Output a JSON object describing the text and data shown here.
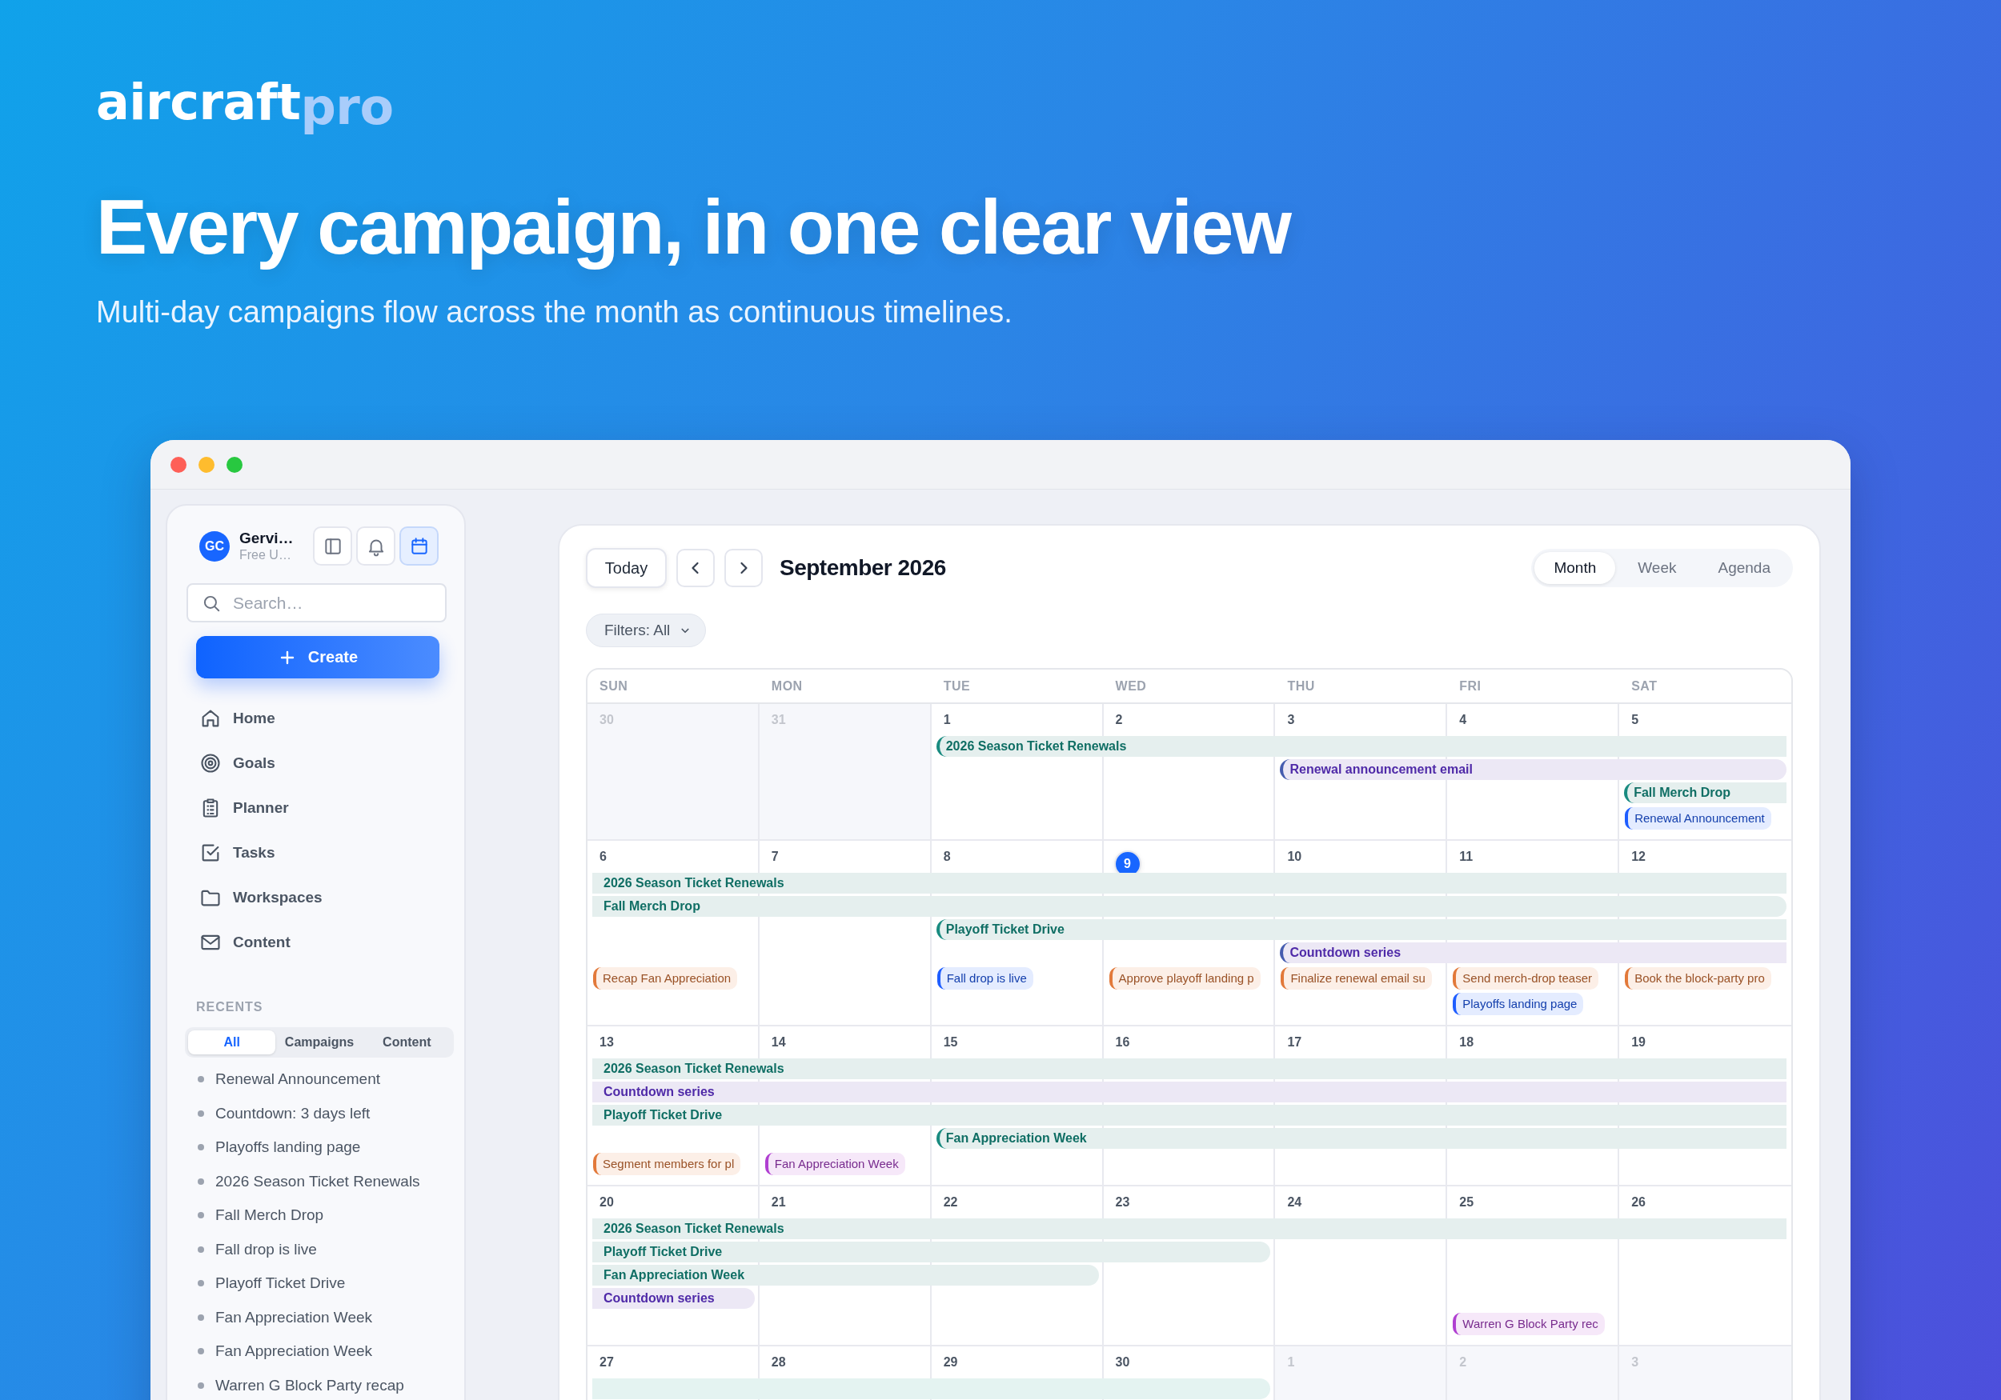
{
  "logo": {
    "word": "aircraft",
    "suffix": "pro"
  },
  "headline": "Every campaign, in one clear view",
  "subtitle": "Multi-day campaigns flow across the month as continuous timelines.",
  "sidebar": {
    "avatar": "GC",
    "name": "Gervi…",
    "plan": "Free U…",
    "header_buttons": [
      {
        "kind": "panel",
        "selected": false
      },
      {
        "kind": "bell",
        "selected": false
      },
      {
        "kind": "calendar",
        "selected": true
      }
    ],
    "search": {
      "placeholder": "Search…"
    },
    "create_button": "Create",
    "nav": [
      {
        "label": "Home",
        "kind": "home"
      },
      {
        "label": "Goals",
        "kind": "target"
      },
      {
        "label": "Planner",
        "kind": "clipboard"
      },
      {
        "label": "Tasks",
        "kind": "check"
      },
      {
        "label": "Workspaces",
        "kind": "folder"
      },
      {
        "label": "Content",
        "kind": "mail"
      }
    ],
    "recents_label": "RECENTS",
    "recents_tabs": [
      {
        "label": "All",
        "selected": true
      },
      {
        "label": "Campaigns",
        "selected": false
      },
      {
        "label": "Content",
        "selected": false
      }
    ],
    "recents": [
      "Renewal Announcement",
      "Countdown: 3 days left",
      "Playoffs landing page",
      "2026 Season Ticket Renewals",
      "Fall Merch Drop",
      "Fall drop is live",
      "Playoff Ticket Drive",
      "Fan Appreciation Week",
      "Fan Appreciation Week",
      "Warren G Block Party recap"
    ]
  },
  "calendar": {
    "today_button": "Today",
    "title": "September 2026",
    "views": [
      {
        "label": "Month",
        "selected": true
      },
      {
        "label": "Week",
        "selected": false
      },
      {
        "label": "Agenda",
        "selected": false
      }
    ],
    "filter": "Filters: All",
    "weekdays": [
      "SUN",
      "MON",
      "TUE",
      "WED",
      "THU",
      "FRI",
      "SAT"
    ],
    "weeks": [
      {
        "days": [
          {
            "label": "30",
            "outside": true,
            "today": false
          },
          {
            "label": "31",
            "outside": true,
            "today": false
          },
          {
            "label": "1",
            "outside": false,
            "today": false
          },
          {
            "label": "2",
            "outside": false,
            "today": false
          },
          {
            "label": "3",
            "outside": false,
            "today": false
          },
          {
            "label": "4",
            "outside": false,
            "today": false
          },
          {
            "label": "5",
            "outside": false,
            "today": false,
            "items": [
              {
                "title": "Renewal Announcement",
                "color": "#1f5eff"
              }
            ]
          }
        ],
        "bars": [
          {
            "title": "2026 Season Ticket Renewals",
            "color": "#0f6e64",
            "starts": true,
            "ends": false,
            "kind": "tuesat"
          },
          {
            "title": "Renewal announcement email",
            "color": "#4f2aa8",
            "starts": true,
            "ends": true,
            "kind": "thusat"
          },
          {
            "title": "Fall Merch Drop",
            "color": "#0f6e64",
            "starts": true,
            "ends": false,
            "kind": "satsat"
          }
        ]
      },
      {
        "days": [
          {
            "label": "6",
            "outside": false,
            "today": false,
            "items": [
              {
                "title": "Recap Fan Appreciation",
                "color": "#e2793a"
              }
            ]
          },
          {
            "label": "7",
            "outside": false,
            "today": false
          },
          {
            "label": "8",
            "outside": false,
            "today": false,
            "items": [
              {
                "title": "Fall drop is live",
                "color": "#1f5eff"
              }
            ]
          },
          {
            "label": "9",
            "outside": false,
            "today": true,
            "items": [
              {
                "title": "Approve playoff landing p",
                "color": "#e2793a"
              }
            ]
          },
          {
            "label": "10",
            "outside": false,
            "today": false,
            "items": [
              {
                "title": "Finalize renewal email su",
                "color": "#e2793a"
              }
            ]
          },
          {
            "label": "11",
            "outside": false,
            "today": false,
            "items": [
              {
                "title": "Send merch-drop teaser",
                "color": "#e2793a"
              },
              {
                "title": "Playoffs landing page",
                "color": "#1f5eff"
              }
            ]
          },
          {
            "label": "12",
            "outside": false,
            "today": false,
            "items": [
              {
                "title": "Book the block-party pro",
                "color": "#e2793a"
              }
            ]
          }
        ],
        "bars": [
          {
            "title": "2026 Season Ticket Renewals",
            "color": "#0f6e64",
            "starts": false,
            "ends": false,
            "kind": "sunsat"
          },
          {
            "title": "Fall Merch Drop",
            "color": "#0f6e64",
            "starts": false,
            "ends": true,
            "kind": "sunsat"
          },
          {
            "title": "Playoff Ticket Drive",
            "color": "#0f6e64",
            "starts": true,
            "ends": false,
            "kind": "tuesat"
          },
          {
            "title": "Countdown series",
            "color": "#4f2aa8",
            "starts": true,
            "ends": false,
            "kind": "thusat"
          }
        ]
      },
      {
        "days": [
          {
            "label": "13",
            "outside": false,
            "today": false,
            "items": [
              {
                "title": "Segment members for pl",
                "color": "#e2793a"
              }
            ]
          },
          {
            "label": "14",
            "outside": false,
            "today": false,
            "items": [
              {
                "title": "Fan Appreciation Week",
                "color": "#b03fd1"
              }
            ]
          },
          {
            "label": "15",
            "outside": false,
            "today": false
          },
          {
            "label": "16",
            "outside": false,
            "today": false
          },
          {
            "label": "17",
            "outside": false,
            "today": false
          },
          {
            "label": "18",
            "outside": false,
            "today": false
          },
          {
            "label": "19",
            "outside": false,
            "today": false
          }
        ],
        "bars": [
          {
            "title": "2026 Season Ticket Renewals",
            "color": "#0f6e64",
            "starts": false,
            "ends": false,
            "kind": "sunsat"
          },
          {
            "title": "Countdown series",
            "color": "#4f2aa8",
            "starts": false,
            "ends": false,
            "kind": "sunsat"
          },
          {
            "title": "Playoff Ticket Drive",
            "color": "#0f6e64",
            "starts": false,
            "ends": false,
            "kind": "sunsat"
          },
          {
            "title": "Fan Appreciation Week",
            "color": "#0f6e64",
            "starts": true,
            "ends": false,
            "kind": "tuesat"
          }
        ]
      },
      {
        "days": [
          {
            "label": "20",
            "outside": false,
            "today": false
          },
          {
            "label": "21",
            "outside": false,
            "today": false
          },
          {
            "label": "22",
            "outside": false,
            "today": false
          },
          {
            "label": "23",
            "outside": false,
            "today": false
          },
          {
            "label": "24",
            "outside": false,
            "today": false
          },
          {
            "label": "25",
            "outside": false,
            "today": false,
            "items": [
              {
                "title": "Warren G Block Party rec",
                "color": "#b03fd1"
              }
            ]
          },
          {
            "label": "26",
            "outside": false,
            "today": false
          }
        ],
        "bars": [
          {
            "title": "2026 Season Ticket Renewals",
            "color": "#0f6e64",
            "starts": false,
            "ends": false,
            "kind": "sunsat"
          },
          {
            "title": "Playoff Ticket Drive",
            "color": "#0f6e64",
            "starts": false,
            "ends": true,
            "kind": "sunwed"
          },
          {
            "title": "Fan Appreciation Week",
            "color": "#0f6e64",
            "starts": false,
            "ends": true,
            "kind": "suntue"
          },
          {
            "title": "Countdown series",
            "color": "#4f2aa8",
            "starts": false,
            "ends": true,
            "kind": "sunsun"
          }
        ]
      },
      {
        "days": [
          {
            "label": "27",
            "outside": false,
            "today": false
          },
          {
            "label": "28",
            "outside": false,
            "today": false
          },
          {
            "label": "29",
            "outside": false,
            "today": false
          },
          {
            "label": "30",
            "outside": false,
            "today": false
          },
          {
            "label": "1",
            "outside": true,
            "today": false
          },
          {
            "label": "2",
            "outside": true,
            "today": false
          },
          {
            "label": "3",
            "outside": true,
            "today": false
          }
        ],
        "bars": [
          {
            "color": "#e4f3f1",
            "starts": false,
            "ends": true,
            "kind": "sunwed"
          }
        ]
      }
    ]
  }
}
